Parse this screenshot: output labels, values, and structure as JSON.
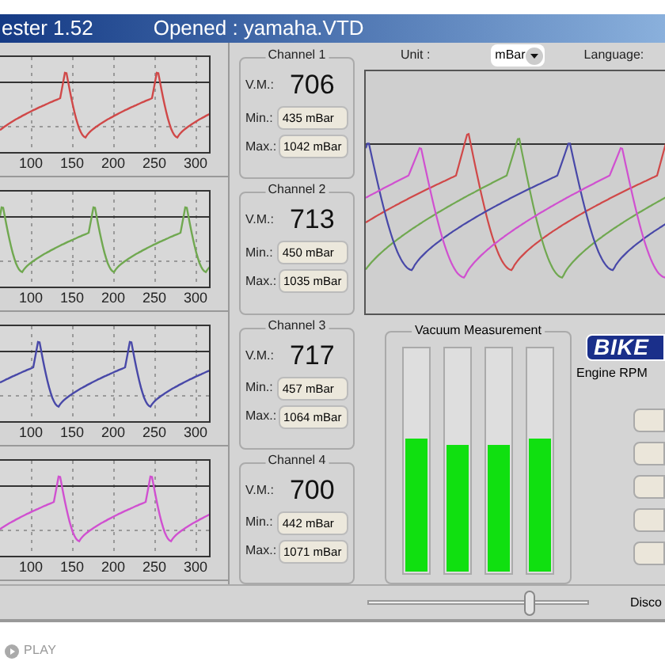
{
  "window": {
    "title": "ester 1.52",
    "file": "Opened : yamaha.VTD"
  },
  "graphs": [
    {
      "color": "#d04848",
      "x_labels": [
        "100",
        "150",
        "200",
        "250",
        "300"
      ]
    },
    {
      "color": "#70a850",
      "x_labels": [
        "100",
        "150",
        "200",
        "250",
        "300"
      ]
    },
    {
      "color": "#4848a8",
      "x_labels": [
        "100",
        "150",
        "200",
        "250",
        "300"
      ]
    },
    {
      "color": "#d050d0",
      "x_labels": [
        "100",
        "150",
        "200",
        "250",
        "300"
      ]
    }
  ],
  "channels": [
    {
      "title": "Channel 1",
      "vm_label": "V.M.:",
      "vm": "706",
      "min_label": "Min.:",
      "min": "435 mBar",
      "max_label": "Max.:",
      "max": "1042 mBar"
    },
    {
      "title": "Channel 2",
      "vm_label": "V.M.:",
      "vm": "713",
      "min_label": "Min.:",
      "min": "450 mBar",
      "max_label": "Max.:",
      "max": "1035 mBar"
    },
    {
      "title": "Channel 3",
      "vm_label": "V.M.:",
      "vm": "717",
      "min_label": "Min.:",
      "min": "457 mBar",
      "max_label": "Max.:",
      "max": "1064 mBar"
    },
    {
      "title": "Channel 4",
      "vm_label": "V.M.:",
      "vm": "700",
      "min_label": "Min.:",
      "min": "442 mBar",
      "max_label": "Max.:",
      "max": "1071 mBar"
    }
  ],
  "unit": {
    "label": "Unit :",
    "value": "mBar"
  },
  "language": {
    "label": "Language:"
  },
  "vacuum": {
    "title": "Vacuum Measurement",
    "bars": [
      {
        "level": 0.6
      },
      {
        "level": 0.57
      },
      {
        "level": 0.57
      },
      {
        "level": 0.6
      }
    ]
  },
  "logo": "BIKE",
  "rpm_label": "Engine RPM",
  "slider": {
    "level": 0.73
  },
  "disconnect_label": "Disco",
  "player": {
    "label": "PLAY"
  }
}
